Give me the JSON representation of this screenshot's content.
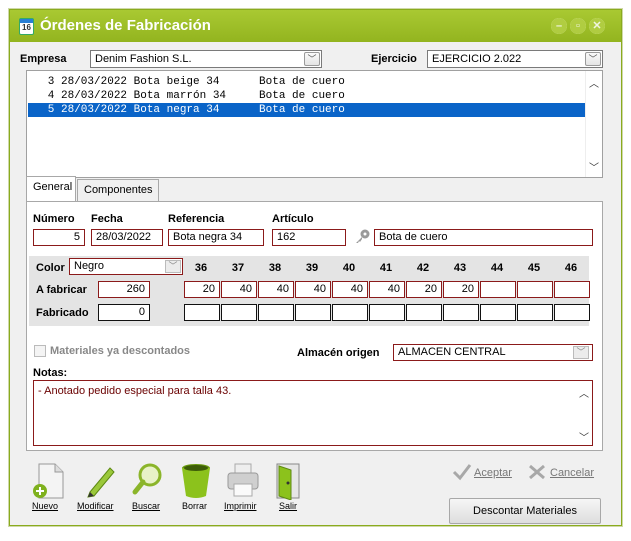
{
  "window": {
    "title": "Órdenes de Fabricación",
    "icon_glyph": "16"
  },
  "header": {
    "empresa_label": "Empresa",
    "empresa_value": "Denim Fashion S.L.",
    "ejercicio_label": "Ejercicio",
    "ejercicio_value": "EJERCICIO 2.022"
  },
  "list": {
    "rows": [
      "   3 28/03/2022 Bota beige 34      Bota de cuero",
      "   4 28/03/2022 Bota marrón 34     Bota de cuero",
      "   5 28/03/2022 Bota negra 34      Bota de cuero"
    ],
    "selected_index": 2
  },
  "tabs": [
    "General",
    "Componentes"
  ],
  "form": {
    "numero_label": "Número",
    "numero": "5",
    "fecha_label": "Fecha",
    "fecha": "28/03/2022",
    "referencia_label": "Referencia",
    "referencia": "Bota negra 34",
    "articulo_label": "Artículo",
    "articulo_code": "162",
    "articulo_desc": "Bota de cuero",
    "color_label": "Color",
    "color_value": "Negro",
    "a_fabricar_label": "A fabricar",
    "a_fabricar_total": "260",
    "fabricado_label": "Fabricado",
    "fabricado_total": "0",
    "sizes": [
      "36",
      "37",
      "38",
      "39",
      "40",
      "41",
      "42",
      "43",
      "44",
      "45",
      "46"
    ],
    "a_fabricar": [
      "20",
      "40",
      "40",
      "40",
      "40",
      "40",
      "20",
      "20",
      "",
      "",
      ""
    ],
    "fabricado": [
      "",
      "",
      "",
      "",
      "",
      "",
      "",
      "",
      "",
      "",
      ""
    ],
    "materiales_label": "Materiales ya descontados",
    "almacen_label": "Almacén origen",
    "almacen_value": "ALMACEN CENTRAL",
    "notas_label": "Notas:",
    "notas": "- Anotado pedido especial para talla 43."
  },
  "toolbar": {
    "nuevo": "Nuevo",
    "modificar": "Modificar",
    "buscar": "Buscar",
    "borrar": "Borrar",
    "imprimir": "Imprimir",
    "salir": "Salir"
  },
  "actions": {
    "aceptar": "Aceptar",
    "cancelar": "Cancelar",
    "descontar": "Descontar Materiales"
  },
  "colors": {
    "title_bar": "#9cbd26",
    "selection": "#0a64c8",
    "field_border": "#8b1a1a"
  }
}
